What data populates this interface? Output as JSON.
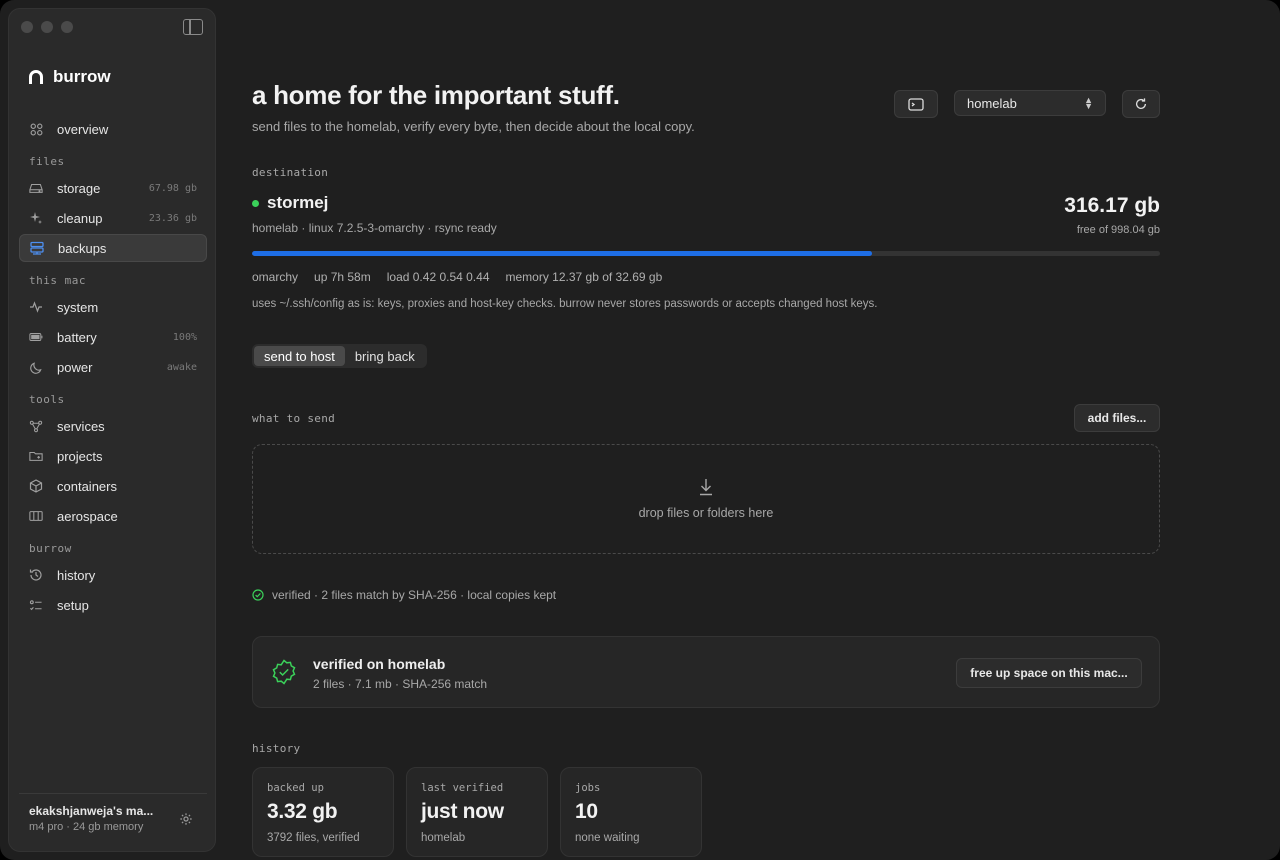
{
  "app": {
    "name": "burrow"
  },
  "sidebar": {
    "sections": [
      {
        "title": "",
        "items": [
          {
            "label": "overview",
            "icon": "grid-icon",
            "meta": ""
          }
        ]
      },
      {
        "title": "files",
        "items": [
          {
            "label": "storage",
            "icon": "drive-icon",
            "meta": "67.98 gb"
          },
          {
            "label": "cleanup",
            "icon": "sparkle-icon",
            "meta": "23.36 gb"
          },
          {
            "label": "backups",
            "icon": "server-icon",
            "meta": "",
            "active": true
          }
        ]
      },
      {
        "title": "this mac",
        "items": [
          {
            "label": "system",
            "icon": "pulse-icon",
            "meta": ""
          },
          {
            "label": "battery",
            "icon": "battery-icon",
            "meta": "100%"
          },
          {
            "label": "power",
            "icon": "moon-icon",
            "meta": "awake"
          }
        ]
      },
      {
        "title": "tools",
        "items": [
          {
            "label": "services",
            "icon": "nodes-icon",
            "meta": ""
          },
          {
            "label": "projects",
            "icon": "folder-icon",
            "meta": ""
          },
          {
            "label": "containers",
            "icon": "box-icon",
            "meta": ""
          },
          {
            "label": "aerospace",
            "icon": "columns-icon",
            "meta": ""
          }
        ]
      },
      {
        "title": "burrow",
        "items": [
          {
            "label": "history",
            "icon": "history-icon",
            "meta": ""
          },
          {
            "label": "setup",
            "icon": "checklist-icon",
            "meta": ""
          }
        ]
      }
    ],
    "account": {
      "name": "ekakshjanweja's ma...",
      "sub": "m4 pro · 24 gb memory"
    }
  },
  "header": {
    "title": "a home for the important stuff.",
    "subtitle": "send files to the homelab, verify every byte, then decide about the local copy.",
    "host_select": "homelab"
  },
  "destination": {
    "label": "destination",
    "host": "stormej",
    "host_sub": "homelab · linux 7.2.5-3-omarchy · rsync ready",
    "free_value": "316.17 gb",
    "free_sub": "free of 998.04 gb",
    "used_fraction": 0.683,
    "stats": [
      "omarchy",
      "up 7h 58m",
      "load 0.42 0.54 0.44",
      "memory 12.37 gb of 32.69 gb"
    ],
    "note": "uses ~/.ssh/config as is: keys, proxies and host-key checks. burrow never stores passwords or accepts changed host keys."
  },
  "mode": {
    "send": "send to host",
    "bring": "bring back"
  },
  "send": {
    "label": "what to send",
    "add_button": "add files...",
    "drop_text": "drop files or folders here"
  },
  "verify_line": "verified · 2 files match by SHA-256 · local copies kept",
  "verified_card": {
    "title": "verified on homelab",
    "sub": "2 files · 7.1 mb · SHA-256 match",
    "button": "free up space on this mac..."
  },
  "history": {
    "label": "history",
    "cards": [
      {
        "label": "backed up",
        "value": "3.32 gb",
        "sub": "3792 files, verified"
      },
      {
        "label": "last verified",
        "value": "just now",
        "sub": "homelab"
      },
      {
        "label": "jobs",
        "value": "10",
        "sub": "none waiting"
      }
    ]
  },
  "colors": {
    "accent": "#1e6ee6",
    "online": "#3bd15a",
    "verified": "#3bd15a"
  }
}
